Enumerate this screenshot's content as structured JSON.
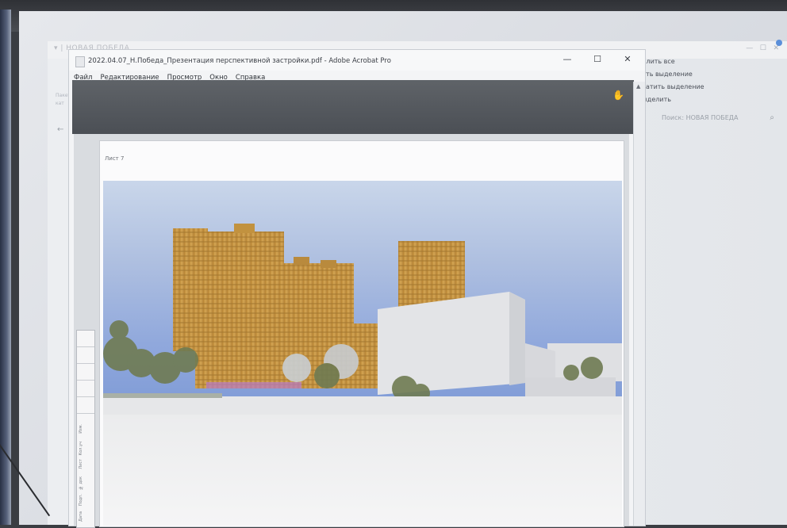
{
  "explorer": {
    "title": "▾ | НОВАЯ ПОБЕДА",
    "ribbon": [
      "делить все",
      "нять выделение",
      "братить выделение",
      "Выделить"
    ],
    "search_placeholder": "Поиск: НОВАЯ ПОБЕДА",
    "side": [
      "Пакет",
      "кат"
    ]
  },
  "acrobat": {
    "title": "2022.04.07_Н.Победа_Презентация перспективной застройки.pdf - Adobe Acrobat Pro",
    "menu": [
      "Файл",
      "Редактирование",
      "Просмотр",
      "Окно",
      "Справка"
    ],
    "page_label": "Лист 7"
  },
  "stamp_labels": [
    "Изм.",
    "Кол.уч",
    "Лист",
    "№ док",
    "Подп.",
    "Дата"
  ],
  "colors": {
    "sky_top": "#c9d6ea",
    "sky_bottom": "#7e9ad6",
    "tower": "#c99a45",
    "white_block": "#e6e7e9",
    "toolbar": "#55595f"
  }
}
